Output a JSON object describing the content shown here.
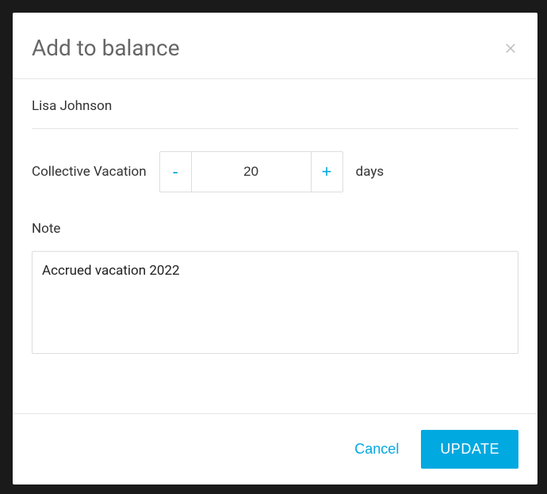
{
  "modal": {
    "title": "Add to balance",
    "employee_name": "Lisa Johnson",
    "balance_type_label": "Collective Vacation",
    "amount": "20",
    "unit": "days",
    "note_label": "Note",
    "note_value": "Accrued vacation 2022",
    "cancel_label": "Cancel",
    "update_label": "UPDATE"
  },
  "icons": {
    "close": "close-icon",
    "minus": "-",
    "plus": "+"
  },
  "colors": {
    "accent": "#00a9e0",
    "text_muted": "#666"
  }
}
